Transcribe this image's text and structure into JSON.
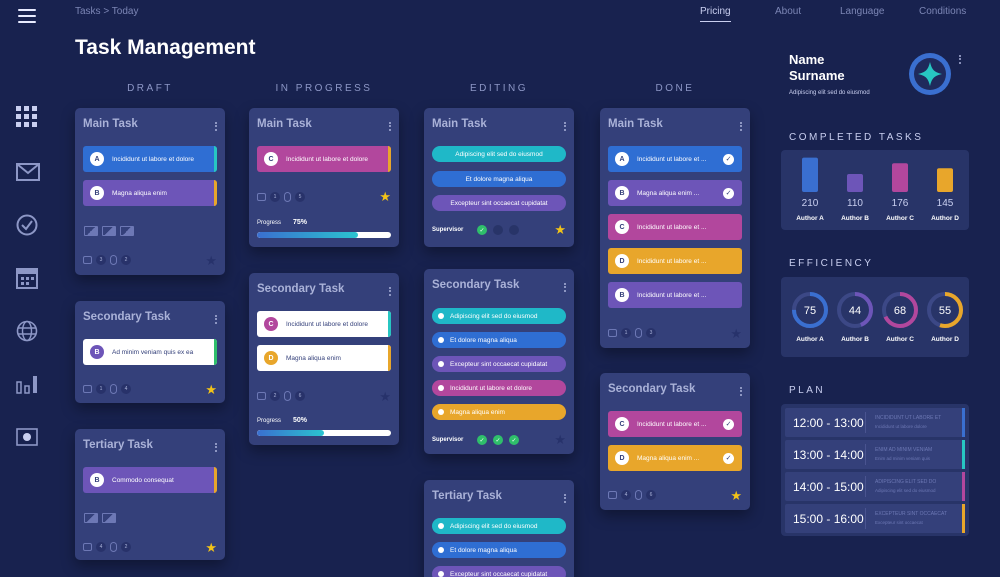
{
  "topbar": {
    "breadcrumb": "Tasks  >  Today",
    "nav": [
      "Pricing",
      "About",
      "Language",
      "Conditions"
    ]
  },
  "page_title": "Task Management",
  "columns": [
    "DRAFT",
    "IN PROGRESS",
    "EDITING",
    "DONE"
  ],
  "sidebar_icons": [
    "apps-grid-icon",
    "mail-icon",
    "check-circle-icon",
    "calendar-icon",
    "globe-icon",
    "bar-chart-icon",
    "record-icon"
  ],
  "labels": {
    "main_task": "Main Task",
    "secondary_task": "Secondary Task",
    "tertiary_task": "Tertiary Task",
    "progress": "Progress",
    "supervisor": "Supervisor"
  },
  "draft": {
    "main": {
      "items": [
        {
          "letter": "A",
          "text": "Incididunt ut labore et dolore",
          "color": "#2f6ed3",
          "edge": "#27c6c2"
        },
        {
          "letter": "B",
          "text": "Magna aliqua enim",
          "color": "#6d55b8",
          "edge": "#e8a62b"
        }
      ],
      "comments": "3",
      "attachments": "2"
    },
    "secondary": {
      "items": [
        {
          "letter": "B",
          "text": "Ad minim veniam  quis ex ea",
          "color": "#ffffff",
          "edge": "#2fbf6b"
        }
      ],
      "comments": "1",
      "attachments": "4"
    },
    "tertiary": {
      "items": [
        {
          "letter": "B",
          "text": "Commodo consequat",
          "color": "#6d55b8",
          "edge": "#e8a62b"
        }
      ],
      "comments": "4",
      "attachments": "2"
    }
  },
  "in_progress": {
    "main": {
      "items": [
        {
          "letter": "C",
          "text": "Incididunt ut labore et dolore",
          "color": "#b2479d",
          "edge": "#e8a62b"
        }
      ],
      "comments": "1",
      "attachments": "5",
      "progress": "75%",
      "progress_value": 0.75
    },
    "secondary": {
      "items": [
        {
          "letter": "C",
          "text": "Incididunt ut labore et dolore",
          "color": "#ffffff",
          "edge": "#27c6c2"
        },
        {
          "letter": "D",
          "text": "Magna aliqua enim",
          "color": "#ffffff",
          "edge": "#e8a62b"
        }
      ],
      "comments": "2",
      "attachments": "6",
      "progress": "50%",
      "progress_value": 0.5
    }
  },
  "editing": {
    "main": [
      "Adipiscing elit sed do eiusmod",
      "Et dolore magna aliqua",
      "Excepteur sint occaecat cupidatat"
    ],
    "secondary": [
      "Adipiscing elit sed do eiusmod",
      "Et dolore magna aliqua",
      "Excepteur sint occaecat cupidatat",
      "Incididunt ut labore et dolore",
      "Magna aliqua enim"
    ],
    "tertiary": [
      "Adipiscing elit sed do eiusmod",
      "Et dolore magna aliqua",
      "Excepteur sint occaecat cupidatat"
    ]
  },
  "done": {
    "main": {
      "items": [
        {
          "letter": "A",
          "text": "Incididunt ut labore et ..."
        },
        {
          "letter": "B",
          "text": "Magna aliqua enim ..."
        },
        {
          "letter": "C",
          "text": "Incididunt ut labore et ..."
        },
        {
          "letter": "D",
          "text": "Incididunt ut labore et ..."
        },
        {
          "letter": "B",
          "text": "Incididunt ut labore et ..."
        }
      ],
      "comments": "1",
      "attachments": "3"
    },
    "secondary": {
      "items": [
        {
          "letter": "C",
          "text": "Incididunt ut labore et ..."
        },
        {
          "letter": "D",
          "text": "Magna aliqua enim ..."
        }
      ],
      "comments": "4",
      "attachments": "6"
    }
  },
  "profile": {
    "name": "Name\nSurname",
    "subtitle": "Adipiscing elit sed do eiusmod"
  },
  "completed_tasks": {
    "heading": "COMPLETED TASKS",
    "authors": [
      "Author A",
      "Author B",
      "Author C",
      "Author D"
    ],
    "values": [
      210,
      110,
      176,
      145
    ],
    "colors": [
      "#3a6fd0",
      "#6d55b8",
      "#b2479d",
      "#e8a62b"
    ]
  },
  "efficiency": {
    "heading": "EFFICIENCY",
    "authors": [
      "Author A",
      "Author B",
      "Author C",
      "Author D"
    ],
    "values": [
      75,
      44,
      68,
      55
    ],
    "colors": [
      "#3a6fd0",
      "#6d55b8",
      "#b2479d",
      "#e8a62b"
    ]
  },
  "plan": {
    "heading": "PLAN",
    "rows": [
      {
        "time": "12:00 - 13:00",
        "line1": "INCIDIDUNT UT LABORE ET",
        "line2": "Incididunt ut labore dolore",
        "color": "#3a6fd0"
      },
      {
        "time": "13:00 - 14:00",
        "line1": "ENIM AD MINIM VENIAM",
        "line2": "Enim ad minim veniam quis",
        "color": "#27c6c2"
      },
      {
        "time": "14:00 - 15:00",
        "line1": "ADIPISCING ELIT SED DO",
        "line2": "Adipiscing elit sed do eiusmod",
        "color": "#b2479d"
      },
      {
        "time": "15:00 - 16:00",
        "line1": "EXCEPTEUR SINT OCCAECAT",
        "line2": "Excepteur sint occaecat",
        "color": "#e8a62b"
      }
    ]
  },
  "colors": {
    "bg": "#18224f",
    "card": "#34407a",
    "blue": "#3a6fd0",
    "purple": "#6d55b8",
    "magenta": "#b2479d",
    "orange": "#e8a62b",
    "teal": "#27c6c2",
    "green": "#2fbf6b"
  }
}
